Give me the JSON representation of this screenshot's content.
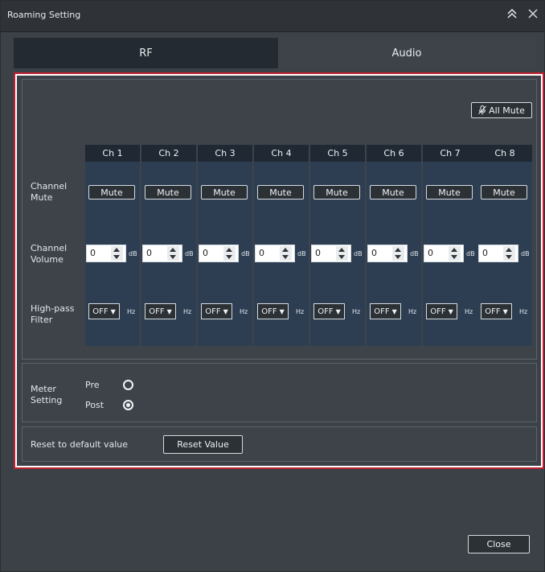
{
  "window": {
    "title": "Roaming Setting"
  },
  "tabs": [
    {
      "label": "RF",
      "active": true
    },
    {
      "label": "Audio",
      "active": false
    }
  ],
  "audio": {
    "all_mute_label": "All Mute",
    "row_labels": {
      "channel_mute": "Channel Mute",
      "channel_volume": "Channel Volume",
      "high_pass_filter": "High-pass Filter"
    },
    "mute_button_label": "Mute",
    "volume_unit": "dB",
    "filter_unit": "Hz",
    "channels": [
      {
        "name": "Ch 1",
        "volume": "0",
        "filter": "OFF"
      },
      {
        "name": "Ch 2",
        "volume": "0",
        "filter": "OFF"
      },
      {
        "name": "Ch 3",
        "volume": "0",
        "filter": "OFF"
      },
      {
        "name": "Ch 4",
        "volume": "0",
        "filter": "OFF"
      },
      {
        "name": "Ch 5",
        "volume": "0",
        "filter": "OFF"
      },
      {
        "name": "Ch 6",
        "volume": "0",
        "filter": "OFF"
      },
      {
        "name": "Ch 7",
        "volume": "0",
        "filter": "OFF"
      },
      {
        "name": "Ch 8",
        "volume": "0",
        "filter": "OFF"
      }
    ]
  },
  "meter": {
    "label": "Meter Setting",
    "options": [
      "Pre",
      "Post"
    ],
    "selected": "Post"
  },
  "reset": {
    "label": "Reset to default value",
    "button": "Reset Value"
  },
  "close_label": "Close",
  "colors": {
    "highlight_border": "#c01f2f",
    "channel_column": "#2d3e53",
    "channel_header": "#1f2833",
    "background": "#3c4148"
  }
}
